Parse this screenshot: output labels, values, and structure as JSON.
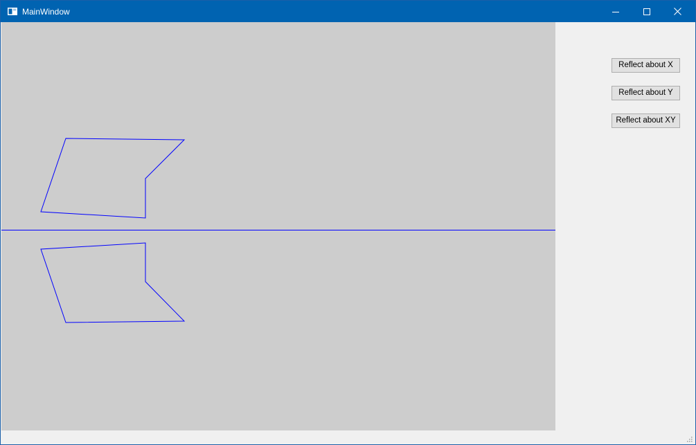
{
  "window": {
    "title": "MainWindow",
    "icons": {
      "app": "window-icon",
      "minimize": "minimize-icon",
      "maximize": "maximize-icon",
      "close": "close-icon"
    }
  },
  "canvas": {
    "background": "#cdcdcd",
    "stroke": "#0000ff"
  },
  "buttons": {
    "reflect_x": "Reflect about X",
    "reflect_y": "Reflect about Y",
    "reflect_xy": "Reflect about XY"
  },
  "colors": {
    "titlebar": "#0063b1",
    "panel": "#f0f0f0",
    "button_face": "#e1e1e1",
    "button_border": "#adadad"
  }
}
